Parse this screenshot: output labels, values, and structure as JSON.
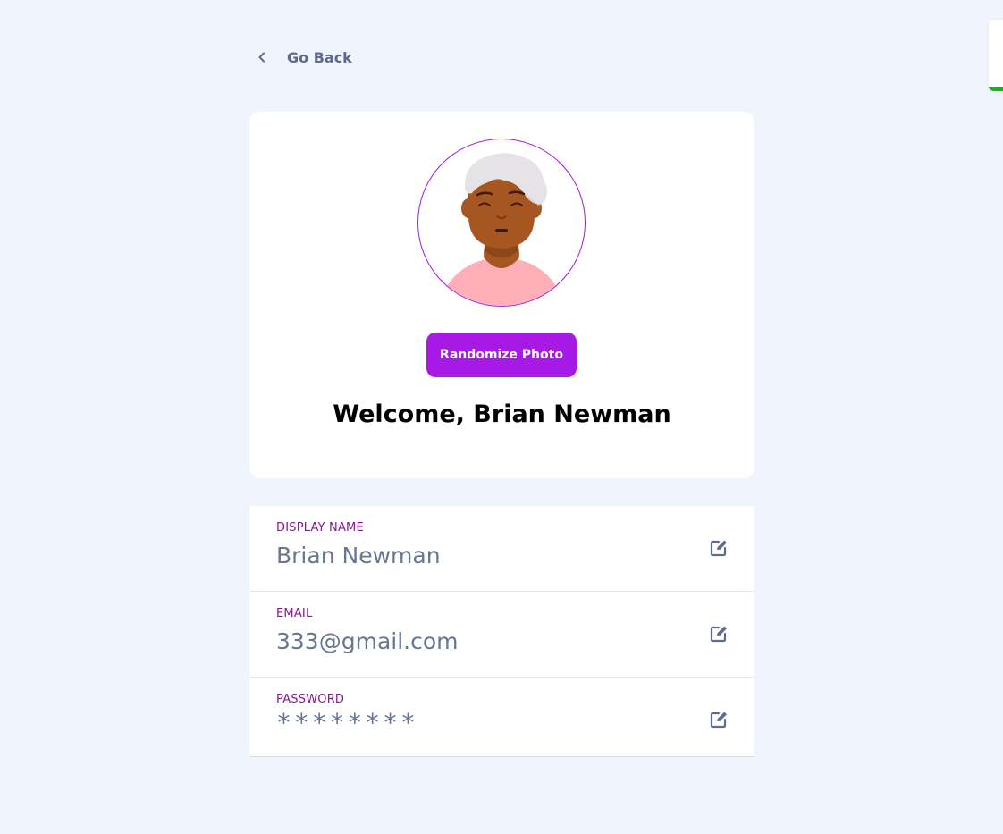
{
  "nav": {
    "back_label": "Go Back"
  },
  "profile": {
    "randomize_label": "Randomize Photo",
    "welcome": "Welcome, Brian Newman"
  },
  "fields": [
    {
      "label": "DISPLAY NAME",
      "value": "Brian Newman",
      "icon": "edit-icon"
    },
    {
      "label": "EMAIL",
      "value": "333@gmail.com",
      "icon": "edit-icon"
    },
    {
      "label": "PASSWORD",
      "value": "********",
      "icon": "edit-icon"
    }
  ],
  "colors": {
    "accent": "#a71ae6",
    "field_label": "#8a1593",
    "field_value": "#6a7592",
    "background": "#f0f4fd",
    "toast_progress": "#17b320"
  },
  "icons": {
    "back": "chevron-left-icon",
    "edit": "edit-icon",
    "avatar": "avatar-illustration"
  }
}
